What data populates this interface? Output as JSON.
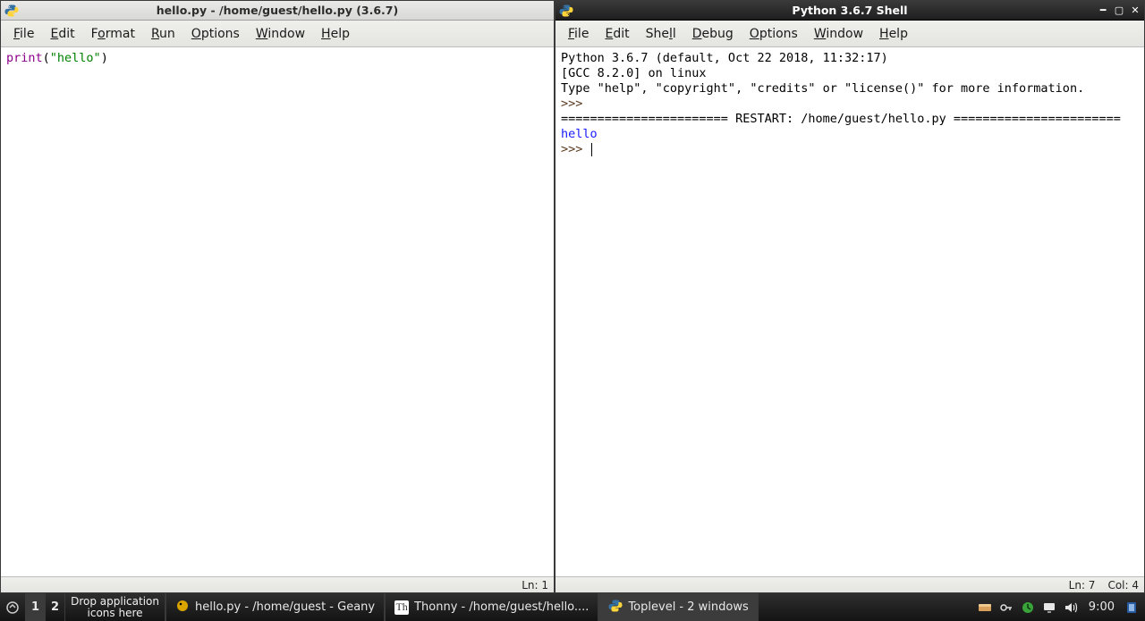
{
  "left_window": {
    "title": "hello.py - /home/guest/hello.py (3.6.7)",
    "menus": [
      "File",
      "Edit",
      "Format",
      "Run",
      "Options",
      "Window",
      "Help"
    ],
    "code": {
      "kw": "print",
      "open": "(",
      "str": "\"hello\"",
      "close": ")"
    },
    "status": {
      "ln_label": "Ln: 1"
    }
  },
  "right_window": {
    "title": "Python 3.6.7 Shell",
    "menus": [
      "File",
      "Edit",
      "Shell",
      "Debug",
      "Options",
      "Window",
      "Help"
    ],
    "shell": {
      "line1": "Python 3.6.7 (default, Oct 22 2018, 11:32:17) ",
      "line2": "[GCC 8.2.0] on linux",
      "line3": "Type \"help\", \"copyright\", \"credits\" or \"license()\" for more information.",
      "prompt1": ">>> ",
      "restart": "======================= RESTART: /home/guest/hello.py =======================",
      "output": "hello",
      "prompt2": ">>> "
    },
    "status": {
      "ln_label": "Ln: 7",
      "col_label": "Col: 4"
    }
  },
  "taskbar": {
    "workspaces": [
      "1",
      "2"
    ],
    "drop_hint": "Drop application\nicons here",
    "tasks": [
      {
        "label": "hello.py - /home/guest - Geany",
        "active": false
      },
      {
        "label": "Thonny  -  /home/guest/hello....",
        "active": false
      },
      {
        "label": "Toplevel - 2 windows",
        "active": true
      }
    ],
    "clock": "9:00"
  }
}
